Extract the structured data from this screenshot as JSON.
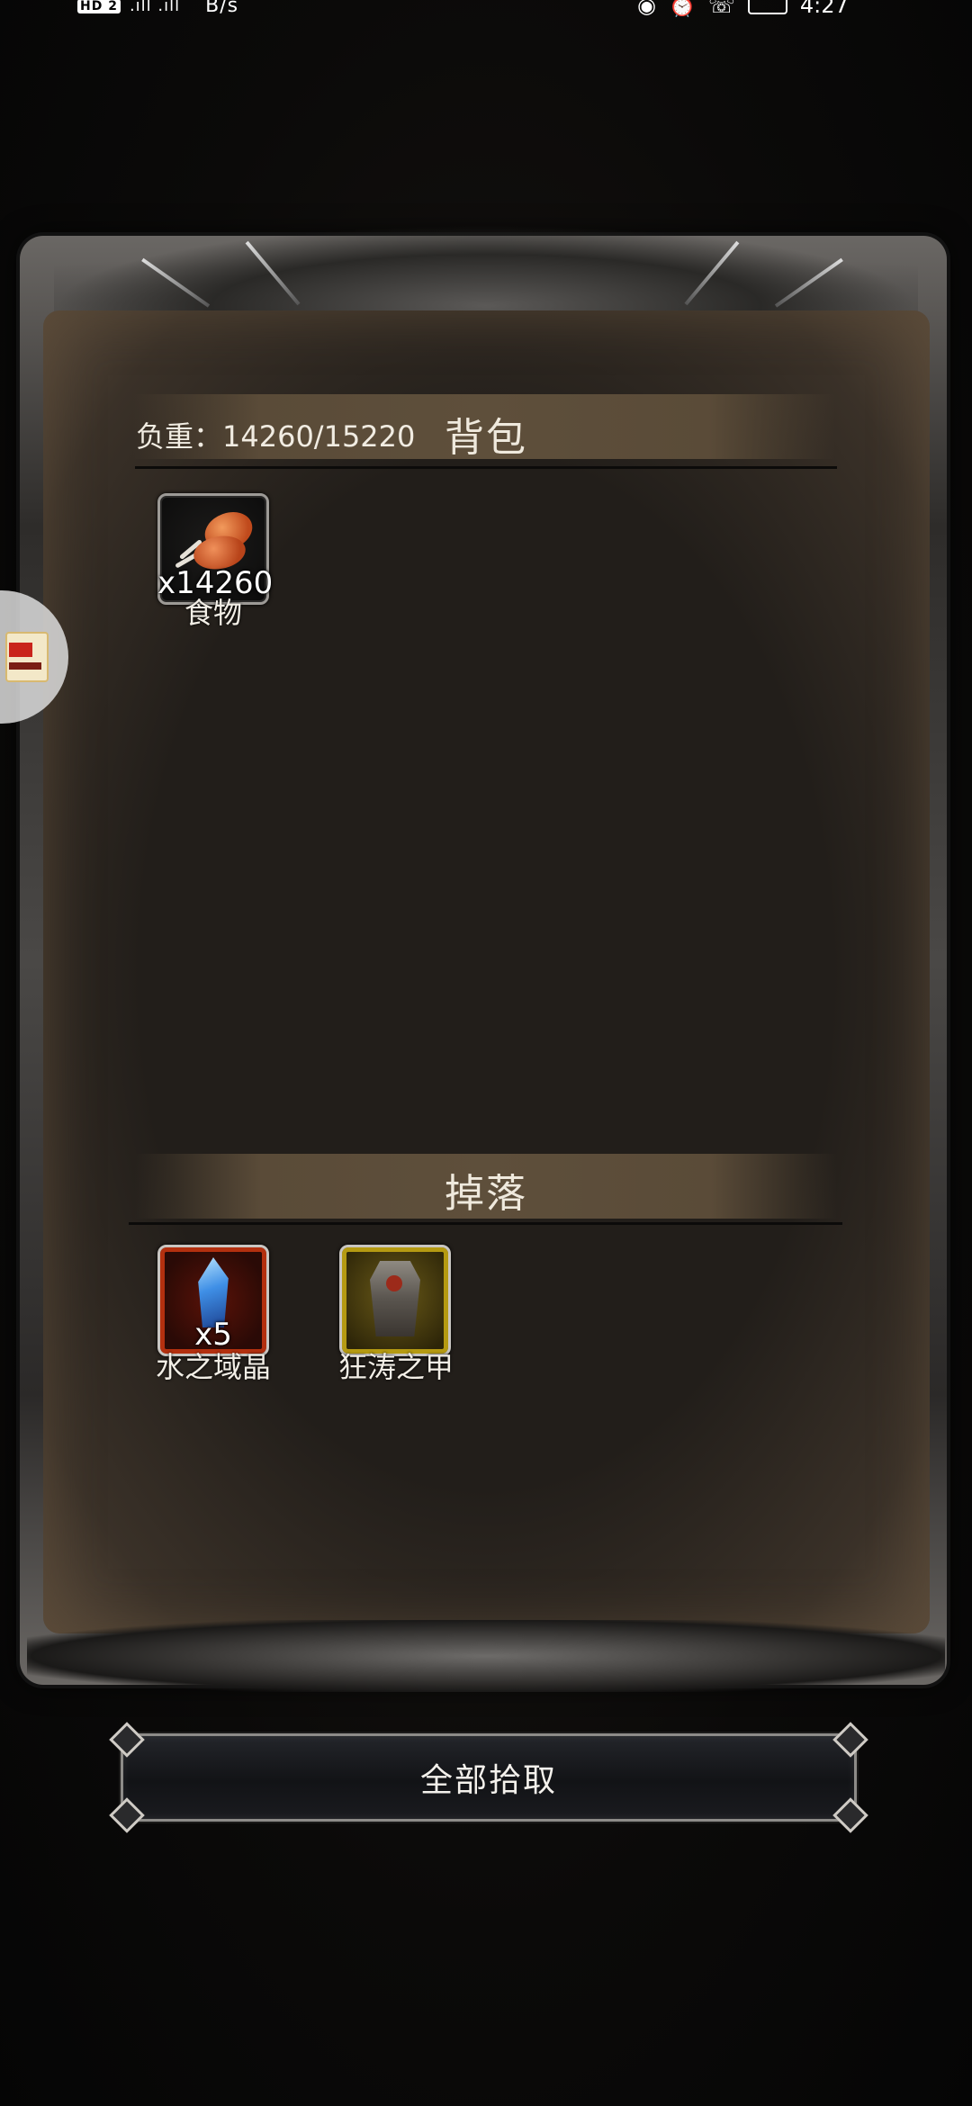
{
  "status_bar": {
    "left_badges": "HD 2",
    "signal": ".ıll  .ıll",
    "speed": "B/s",
    "icons": [
      "eye-icon",
      "alarm-icon",
      "wifi-call-icon",
      "battery-icon"
    ],
    "time": "4:27"
  },
  "inventory": {
    "weight_text": "负重：14260/15220",
    "title": "背包",
    "items": [
      {
        "name": "食物",
        "quantity": "x14260",
        "icon": "meat-drumstick-icon"
      }
    ]
  },
  "drops": {
    "title": "掉落",
    "items": [
      {
        "name": "水之域晶",
        "quantity": "x5",
        "icon": "blue-crystal-icon",
        "rarity_color": "#b3300f"
      },
      {
        "name": "狂涛之甲",
        "quantity": "",
        "icon": "plate-armor-icon",
        "rarity_color": "#b59a12"
      }
    ]
  },
  "actions": {
    "collect_all_label": "全部拾取"
  }
}
